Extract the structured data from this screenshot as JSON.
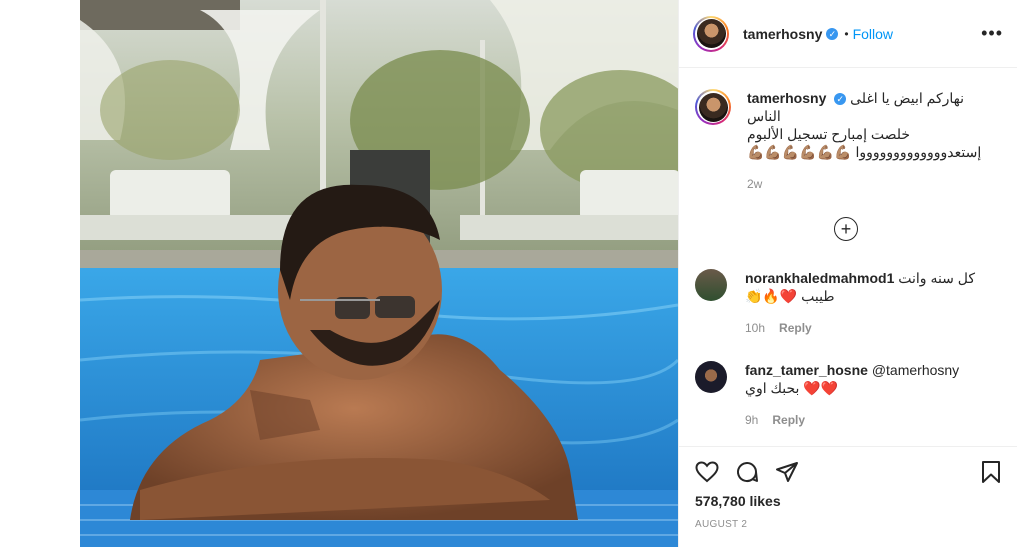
{
  "post": {
    "username": "tamerhosny",
    "follow_label": "Follow",
    "more_label": "•••",
    "caption": "نهاركم ابيض يا اغلى الناس\nخلصت إمبارح تسجيل الألبوم\nإستعدوووووووووووووا 💪🏽💪🏽💪🏽💪🏽💪🏽💪🏽",
    "caption_time": "2w",
    "load_more_icon": "plus-circle-icon",
    "likes": "578,780 likes",
    "date": "AUGUST 2"
  },
  "comments": [
    {
      "username": "norankhaledmahmod1",
      "text": "كل سنه وانت طيبب ❤️🔥👏",
      "time": "10h",
      "reply_label": "Reply"
    },
    {
      "username": "fanz_tamer_hosne",
      "text": "@tamerhosny بحبك اوي ❤️❤️",
      "time": "9h",
      "reply_label": "Reply"
    }
  ],
  "colors": {
    "accent": "#0095f6",
    "verified": "#3897f0",
    "muted": "#8e8e8e"
  }
}
